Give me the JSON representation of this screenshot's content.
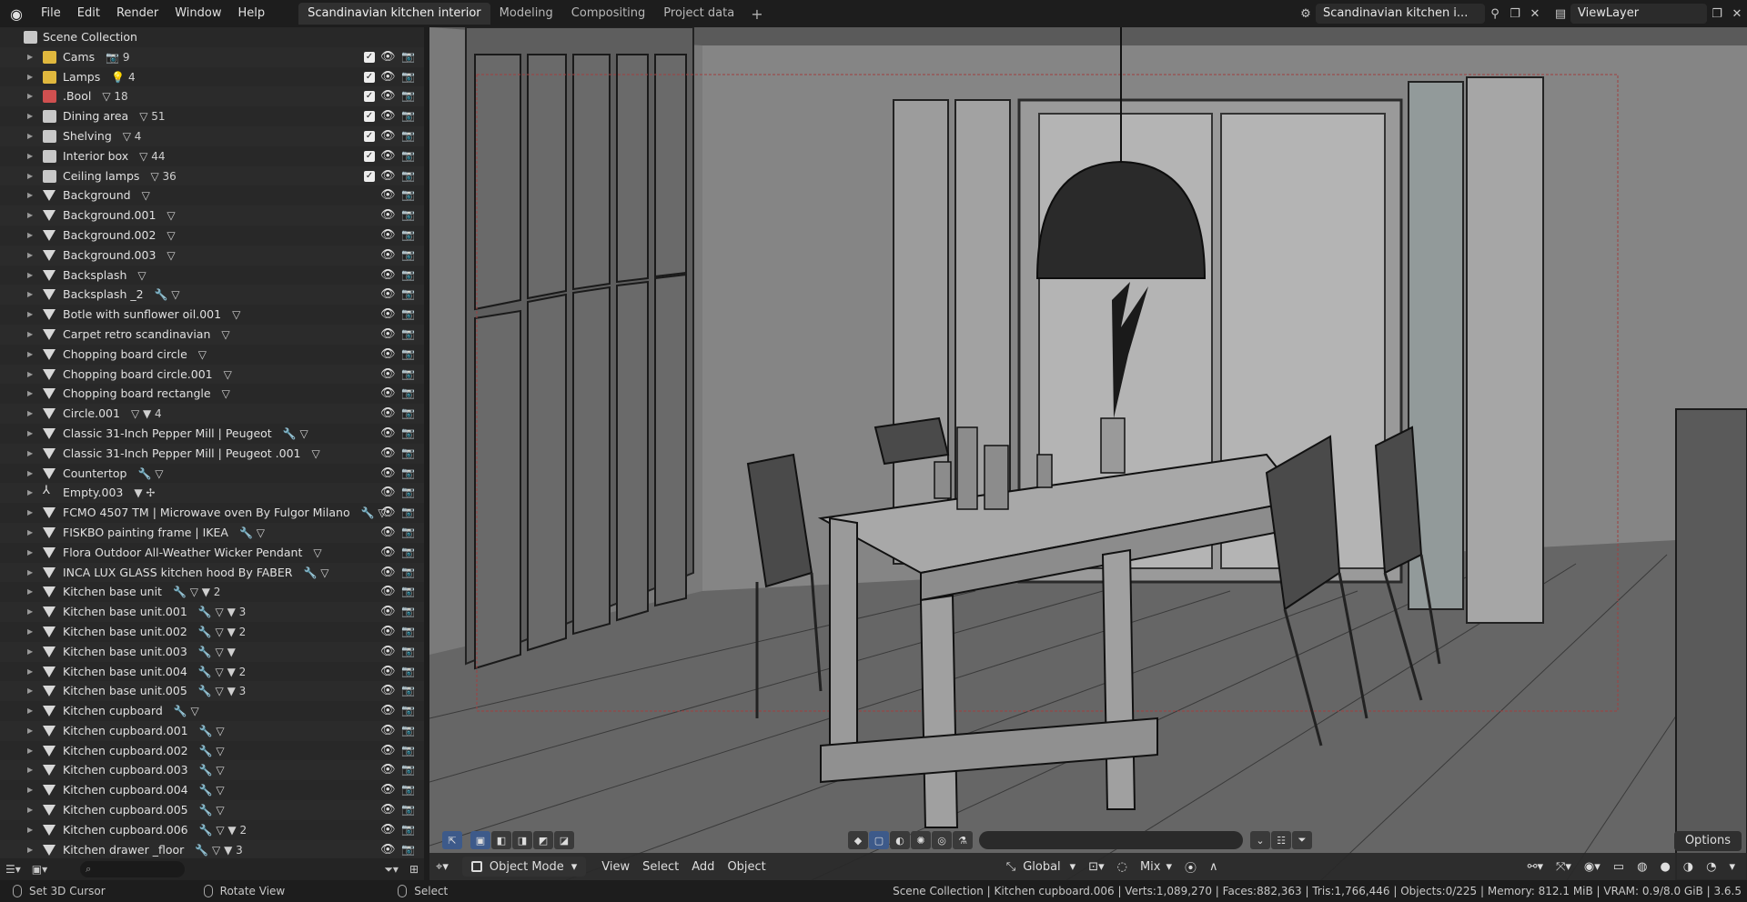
{
  "topbar": {
    "menu": [
      "File",
      "Edit",
      "Render",
      "Window",
      "Help"
    ],
    "tabs": [
      {
        "label": "Scandinavian kitchen interior",
        "active": true
      },
      {
        "label": "Modeling",
        "active": false
      },
      {
        "label": "Compositing",
        "active": false
      },
      {
        "label": "Project data",
        "active": false
      }
    ],
    "add_tab": "+",
    "scene_name": "Scandinavian kitchen i...",
    "view_layer": "ViewLayer"
  },
  "outliner": {
    "root_label": "Scene Collection",
    "rows": [
      {
        "name": "Cams",
        "type": "collection",
        "color": "#e0b83e",
        "extra": "📷 9",
        "checkbox": true
      },
      {
        "name": "Lamps",
        "type": "collection",
        "color": "#e0b83e",
        "extra": "💡 4",
        "checkbox": true
      },
      {
        "name": ".Bool",
        "type": "collection",
        "color": "#d05050",
        "extra": "▽ 18",
        "checkbox": true
      },
      {
        "name": "Dining area",
        "type": "collection",
        "color": "#c8c8c8",
        "extra": "▽ 51",
        "checkbox": true
      },
      {
        "name": "Shelving",
        "type": "collection",
        "color": "#c8c8c8",
        "extra": "▽ 4",
        "checkbox": true
      },
      {
        "name": "Interior box",
        "type": "collection",
        "color": "#c8c8c8",
        "extra": "▽ 44",
        "checkbox": true
      },
      {
        "name": "Ceiling lamps",
        "type": "collection",
        "color": "#c8c8c8",
        "extra": "▽ 36",
        "checkbox": true
      },
      {
        "name": "Background",
        "type": "mesh",
        "extra": "▽"
      },
      {
        "name": "Background.001",
        "type": "mesh",
        "extra": "▽"
      },
      {
        "name": "Background.002",
        "type": "mesh",
        "extra": "▽"
      },
      {
        "name": "Background.003",
        "type": "mesh",
        "extra": "▽"
      },
      {
        "name": "Backsplash",
        "type": "mesh",
        "extra": "▽"
      },
      {
        "name": "Backsplash _2",
        "type": "mesh",
        "extra": "🔧 ▽"
      },
      {
        "name": "Botle with sunflower oil.001",
        "type": "mesh",
        "extra": "▽"
      },
      {
        "name": "Carpet retro scandinavian",
        "type": "mesh",
        "extra": "▽"
      },
      {
        "name": "Chopping board circle",
        "type": "mesh",
        "extra": "▽"
      },
      {
        "name": "Chopping board circle.001",
        "type": "mesh",
        "extra": "▽"
      },
      {
        "name": "Chopping board rectangle",
        "type": "mesh",
        "extra": "▽"
      },
      {
        "name": "Circle.001",
        "type": "mesh",
        "extra": "▽ ▼ 4"
      },
      {
        "name": "Classic 31-Inch Pepper Mill | Peugeot",
        "type": "mesh",
        "extra": "🔧 ▽"
      },
      {
        "name": "Classic 31-Inch Pepper Mill | Peugeot .001",
        "type": "mesh",
        "extra": "▽"
      },
      {
        "name": "Countertop",
        "type": "mesh",
        "extra": "🔧 ▽"
      },
      {
        "name": "Empty.003",
        "type": "empty",
        "extra": "▼ ✢"
      },
      {
        "name": "FCMO 4507 TM | Microwave oven By Fulgor Milano",
        "type": "mesh",
        "extra": "🔧 ▽"
      },
      {
        "name": "FISKBO painting frame | IKEA",
        "type": "mesh",
        "extra": "🔧 ▽"
      },
      {
        "name": "Flora Outdoor All-Weather Wicker Pendant",
        "type": "mesh",
        "extra": "▽"
      },
      {
        "name": "INCA LUX GLASS kitchen hood By FABER",
        "type": "mesh",
        "extra": "🔧 ▽"
      },
      {
        "name": "Kitchen base unit",
        "type": "mesh",
        "extra": "🔧 ▽ ▼ 2"
      },
      {
        "name": "Kitchen base unit.001",
        "type": "mesh",
        "extra": "🔧 ▽ ▼ 3"
      },
      {
        "name": "Kitchen base unit.002",
        "type": "mesh",
        "extra": "🔧 ▽ ▼ 2"
      },
      {
        "name": "Kitchen base unit.003",
        "type": "mesh",
        "extra": "🔧 ▽ ▼"
      },
      {
        "name": "Kitchen base unit.004",
        "type": "mesh",
        "extra": "🔧 ▽ ▼ 2"
      },
      {
        "name": "Kitchen base unit.005",
        "type": "mesh",
        "extra": "🔧 ▽ ▼ 3"
      },
      {
        "name": "Kitchen cupboard",
        "type": "mesh",
        "extra": "🔧 ▽"
      },
      {
        "name": "Kitchen cupboard.001",
        "type": "mesh",
        "extra": "🔧 ▽"
      },
      {
        "name": "Kitchen cupboard.002",
        "type": "mesh",
        "extra": "🔧 ▽"
      },
      {
        "name": "Kitchen cupboard.003",
        "type": "mesh",
        "extra": "🔧 ▽"
      },
      {
        "name": "Kitchen cupboard.004",
        "type": "mesh",
        "extra": "🔧 ▽"
      },
      {
        "name": "Kitchen cupboard.005",
        "type": "mesh",
        "extra": "🔧 ▽"
      },
      {
        "name": "Kitchen cupboard.006",
        "type": "mesh",
        "extra": "🔧 ▽ ▼ 2"
      },
      {
        "name": "Kitchen drawer _floor",
        "type": "mesh",
        "extra": "🔧 ▽ ▼ 3"
      }
    ]
  },
  "viewport": {
    "mode": "Object Mode",
    "menus": [
      "View",
      "Select",
      "Add",
      "Object"
    ],
    "transform_orientation": "Global",
    "overlay_blend": "Mix",
    "options_label": "Options"
  },
  "statusbar": {
    "left": [
      "Set 3D Cursor",
      "Rotate View",
      "Select"
    ],
    "stats": "Scene Collection | Kitchen cupboard.006 | Verts:1,089,270 | Faces:882,363 | Tris:1,766,446 | Objects:0/225 | Memory: 812.1 MiB | VRAM: 0.9/8.0 GiB | 3.6.5"
  }
}
